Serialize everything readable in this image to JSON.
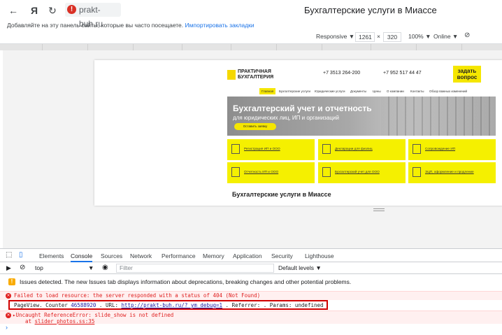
{
  "browser": {
    "back_glyph": "←",
    "yandex_glyph": "Я",
    "reload_glyph": "↻",
    "address": "prakt-buh.ru",
    "warning_glyph": "!",
    "page_title": "Бухгалтерские услуги в Миассе",
    "bookmarks_text": "Добавляйте на эту панель сайты, которые вы часто посещаете.",
    "bookmarks_link": "Импортировать закладки"
  },
  "device_toolbar": {
    "mode": "Responsive ▼",
    "width": "1261",
    "times": "×",
    "height": "320",
    "zoom": "100% ▼",
    "network": "Online ▼",
    "rotate_glyph": "⊘"
  },
  "site": {
    "logo_text": "ПРАКТИЧНАЯ БУХГАЛТЕРИЯ",
    "phone1": "+7 3513 264-200",
    "phone2": "+7 952 517 44 47",
    "ask_button": "задать вопрос",
    "menu": [
      "Главная",
      "Бухгалтерские услуги",
      "Юридические услуги",
      "Документы",
      "Цены",
      "О компании",
      "Контакты",
      "Обзор важных изменений"
    ],
    "banner_title": "Бухгалтерский учет и отчетность",
    "banner_sub": "для юридических лиц, ИП и организаций",
    "banner_button": "Оставить заявку",
    "tiles": [
      "Регистрация ИП и ООО",
      "Декларации для физлиц",
      "Сопровождение ИП",
      "Отчетность ИП и ООО",
      "Бухгалтерский учет для ООО",
      "ЭЦП, оформление и продление"
    ],
    "heading": "Бухгалтерские услуги в Миассе"
  },
  "devtools": {
    "tabs": [
      "Elements",
      "Console",
      "Sources",
      "Network",
      "Performance",
      "Memory",
      "Application",
      "Security",
      "Lighthouse"
    ],
    "active_tab": "Console",
    "context": "top",
    "context_arrow": "▼",
    "filter_placeholder": "Filter",
    "levels": "Default levels ▼",
    "issues_text": "Issues detected. The new Issues tab displays information about deprecations, breaking changes and other potential problems.",
    "error1": "Failed to load resource: the server responded with a status of 404 (Not Found)",
    "pageview": {
      "prefix": "PageView. Counter",
      "counter": "46588920",
      "url_label": ". URL:",
      "url": "http://prakt-buh.ru/?_ym_debug=1",
      "referrer": ". Referrer:",
      "params": ". Params:",
      "params_value": "undefined"
    },
    "error2": "▸Uncaught ReferenceError: slide_show is not defined",
    "error2_at": "at",
    "error2_src": "slider_photos.ss:35",
    "prompt": "›"
  }
}
